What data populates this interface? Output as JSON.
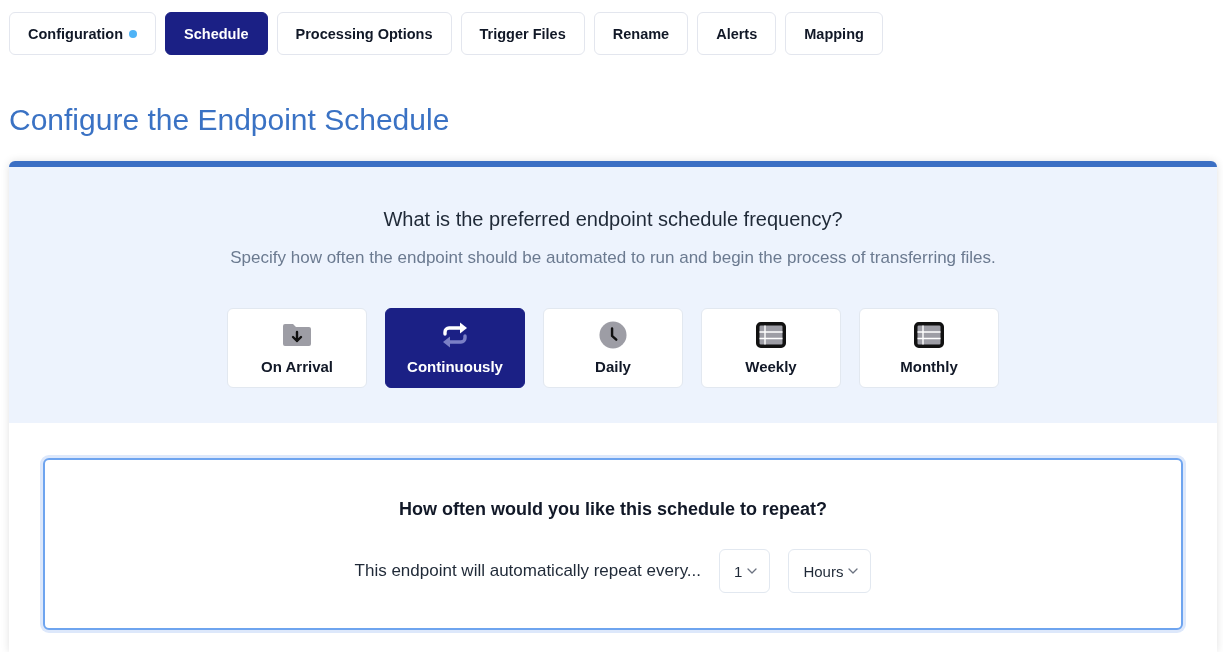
{
  "tabs": [
    {
      "label": "Configuration",
      "selected": false,
      "dot": true
    },
    {
      "label": "Schedule",
      "selected": true,
      "dot": false
    },
    {
      "label": "Processing Options",
      "selected": false,
      "dot": false
    },
    {
      "label": "Trigger Files",
      "selected": false,
      "dot": false
    },
    {
      "label": "Rename",
      "selected": false,
      "dot": false
    },
    {
      "label": "Alerts",
      "selected": false,
      "dot": false
    },
    {
      "label": "Mapping",
      "selected": false,
      "dot": false
    }
  ],
  "page_title": "Configure the Endpoint Schedule",
  "frequency": {
    "question": "What is the preferred endpoint schedule frequency?",
    "description": "Specify how often the endpoint should be automated to run and begin the process of transferring files.",
    "options": [
      {
        "label": "On Arrival",
        "kind": "arrival",
        "selected": false
      },
      {
        "label": "Continuously",
        "kind": "continuous",
        "selected": true
      },
      {
        "label": "Daily",
        "kind": "daily",
        "selected": false
      },
      {
        "label": "Weekly",
        "kind": "weekly",
        "selected": false
      },
      {
        "label": "Monthly",
        "kind": "monthly",
        "selected": false
      }
    ]
  },
  "repeat": {
    "question": "How often would you like this schedule to repeat?",
    "sentence": "This endpoint will automatically repeat every...",
    "interval": {
      "value": "1"
    },
    "unit": {
      "value": "Hours"
    }
  }
}
